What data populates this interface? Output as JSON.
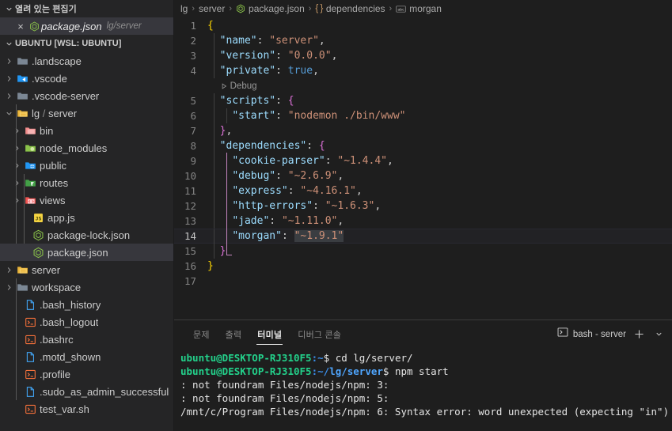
{
  "sidebar": {
    "open_editors": {
      "title": "열려 있는 편집기",
      "items": [
        {
          "name": "package.json",
          "path": "lg/server",
          "icon": "nodejs-json-icon",
          "close": "×"
        }
      ]
    },
    "explorer_root": "UBUNTU [WSL: UBUNTU]",
    "tree": [
      {
        "label": ".landscape",
        "type": "folder",
        "icon": "folder-grey-icon",
        "expanded": false,
        "depth": 1
      },
      {
        "label": ".vscode",
        "type": "folder",
        "icon": "folder-vscode-icon",
        "expanded": false,
        "depth": 1
      },
      {
        "label": ".vscode-server",
        "type": "folder",
        "icon": "folder-grey-icon",
        "expanded": false,
        "depth": 1
      },
      {
        "label": "lg",
        "label_suffix": "server",
        "type": "folder",
        "icon": "folder-open-yellow-icon",
        "expanded": true,
        "depth": 1
      },
      {
        "label": "bin",
        "type": "folder",
        "icon": "folder-pink-icon",
        "expanded": false,
        "depth": 2
      },
      {
        "label": "node_modules",
        "type": "folder",
        "icon": "folder-node-icon",
        "expanded": false,
        "depth": 2
      },
      {
        "label": "public",
        "type": "folder",
        "icon": "folder-public-icon",
        "expanded": false,
        "depth": 2
      },
      {
        "label": "routes",
        "type": "folder",
        "icon": "folder-routes-icon",
        "expanded": false,
        "depth": 2
      },
      {
        "label": "views",
        "type": "folder",
        "icon": "folder-views-icon",
        "expanded": false,
        "depth": 2
      },
      {
        "label": "app.js",
        "type": "file",
        "icon": "javascript-icon",
        "depth": 3
      },
      {
        "label": "package-lock.json",
        "type": "file",
        "icon": "nodejs-json-icon",
        "depth": 3
      },
      {
        "label": "package.json",
        "type": "file",
        "icon": "nodejs-json-icon",
        "depth": 3,
        "selected": true
      },
      {
        "label": "server",
        "type": "folder",
        "icon": "folder-open-yellow-icon",
        "expanded": false,
        "depth": 1
      },
      {
        "label": "workspace",
        "type": "folder",
        "icon": "folder-grey-icon",
        "expanded": false,
        "depth": 1
      },
      {
        "label": ".bash_history",
        "type": "file",
        "icon": "file-blue-icon",
        "depth": 2
      },
      {
        "label": ".bash_logout",
        "type": "file",
        "icon": "console-icon",
        "depth": 2
      },
      {
        "label": ".bashrc",
        "type": "file",
        "icon": "console-icon",
        "depth": 2
      },
      {
        "label": ".motd_shown",
        "type": "file",
        "icon": "file-blue-icon",
        "depth": 2
      },
      {
        "label": ".profile",
        "type": "file",
        "icon": "console-icon",
        "depth": 2
      },
      {
        "label": ".sudo_as_admin_successful",
        "type": "file",
        "icon": "file-blue-icon",
        "depth": 2
      },
      {
        "label": "test_var.sh",
        "type": "file",
        "icon": "console-icon",
        "depth": 2
      }
    ]
  },
  "breadcrumbs": {
    "items": [
      {
        "label": "lg",
        "icon": null
      },
      {
        "label": "server",
        "icon": null
      },
      {
        "label": "package.json",
        "icon": "nodejs-json-icon"
      },
      {
        "label": "dependencies",
        "icon": "braces-icon"
      },
      {
        "label": "morgan",
        "icon": "string-abc-icon"
      }
    ],
    "separator": "›"
  },
  "editor": {
    "active_line": 14,
    "codelens": {
      "line_after": 4,
      "label": "Debug",
      "icon": "run-triangle-icon"
    },
    "lines": [
      {
        "n": 1,
        "indent": 0,
        "tokens": [
          {
            "t": "{",
            "c": "br-y"
          }
        ]
      },
      {
        "n": 2,
        "indent": 1,
        "tokens": [
          {
            "t": "\"name\"",
            "c": "key"
          },
          {
            "t": ": ",
            "c": "punct"
          },
          {
            "t": "\"server\"",
            "c": "str"
          },
          {
            "t": ",",
            "c": "punct"
          }
        ]
      },
      {
        "n": 3,
        "indent": 1,
        "tokens": [
          {
            "t": "\"version\"",
            "c": "key"
          },
          {
            "t": ": ",
            "c": "punct"
          },
          {
            "t": "\"0.0.0\"",
            "c": "str"
          },
          {
            "t": ",",
            "c": "punct"
          }
        ]
      },
      {
        "n": 4,
        "indent": 1,
        "tokens": [
          {
            "t": "\"private\"",
            "c": "key"
          },
          {
            "t": ": ",
            "c": "punct"
          },
          {
            "t": "true",
            "c": "bool"
          },
          {
            "t": ",",
            "c": "punct"
          }
        ]
      },
      {
        "n": 5,
        "indent": 1,
        "tokens": [
          {
            "t": "\"scripts\"",
            "c": "key"
          },
          {
            "t": ": ",
            "c": "punct"
          },
          {
            "t": "{",
            "c": "br-p"
          }
        ]
      },
      {
        "n": 6,
        "indent": 2,
        "tokens": [
          {
            "t": "\"start\"",
            "c": "key"
          },
          {
            "t": ": ",
            "c": "punct"
          },
          {
            "t": "\"nodemon ./bin/www\"",
            "c": "str"
          }
        ]
      },
      {
        "n": 7,
        "indent": 1,
        "tokens": [
          {
            "t": "}",
            "c": "br-p"
          },
          {
            "t": ",",
            "c": "punct"
          }
        ]
      },
      {
        "n": 8,
        "indent": 1,
        "tokens": [
          {
            "t": "\"dependencies\"",
            "c": "key"
          },
          {
            "t": ": ",
            "c": "punct"
          },
          {
            "t": "{",
            "c": "br-p"
          }
        ]
      },
      {
        "n": 9,
        "indent": 2,
        "tokens": [
          {
            "t": "\"cookie-parser\"",
            "c": "key"
          },
          {
            "t": ": ",
            "c": "punct"
          },
          {
            "t": "\"~1.4.4\"",
            "c": "str"
          },
          {
            "t": ",",
            "c": "punct"
          }
        ]
      },
      {
        "n": 10,
        "indent": 2,
        "tokens": [
          {
            "t": "\"debug\"",
            "c": "key"
          },
          {
            "t": ": ",
            "c": "punct"
          },
          {
            "t": "\"~2.6.9\"",
            "c": "str"
          },
          {
            "t": ",",
            "c": "punct"
          }
        ]
      },
      {
        "n": 11,
        "indent": 2,
        "tokens": [
          {
            "t": "\"express\"",
            "c": "key"
          },
          {
            "t": ": ",
            "c": "punct"
          },
          {
            "t": "\"~4.16.1\"",
            "c": "str"
          },
          {
            "t": ",",
            "c": "punct"
          }
        ]
      },
      {
        "n": 12,
        "indent": 2,
        "tokens": [
          {
            "t": "\"http-errors\"",
            "c": "key"
          },
          {
            "t": ": ",
            "c": "punct"
          },
          {
            "t": "\"~1.6.3\"",
            "c": "str"
          },
          {
            "t": ",",
            "c": "punct"
          }
        ]
      },
      {
        "n": 13,
        "indent": 2,
        "tokens": [
          {
            "t": "\"jade\"",
            "c": "key"
          },
          {
            "t": ": ",
            "c": "punct"
          },
          {
            "t": "\"~1.11.0\"",
            "c": "str"
          },
          {
            "t": ",",
            "c": "punct"
          }
        ]
      },
      {
        "n": 14,
        "indent": 2,
        "tokens": [
          {
            "t": "\"morgan\"",
            "c": "key"
          },
          {
            "t": ": ",
            "c": "punct"
          },
          {
            "t": "\"~1.9.1\"",
            "c": "str",
            "sel": true
          }
        ]
      },
      {
        "n": 15,
        "indent": 1,
        "tokens": [
          {
            "t": "}",
            "c": "br-p"
          }
        ]
      },
      {
        "n": 16,
        "indent": 0,
        "tokens": [
          {
            "t": "}",
            "c": "br-y"
          }
        ]
      },
      {
        "n": 17,
        "indent": 0,
        "tokens": []
      }
    ]
  },
  "panel": {
    "tabs": [
      {
        "label": "문제",
        "active": false
      },
      {
        "label": "출력",
        "active": false
      },
      {
        "label": "터미널",
        "active": true
      },
      {
        "label": "디버그 콘솔",
        "active": false
      }
    ],
    "terminal_selector": {
      "label": "bash - server",
      "icon": "terminal-icon"
    },
    "actions": [
      {
        "name": "new-terminal-button",
        "glyph": "+"
      },
      {
        "name": "terminal-dropdown-button",
        "glyph": "⌄"
      }
    ],
    "terminal_lines": [
      {
        "segments": [
          {
            "t": "ubuntu@DESKTOP-RJ310F5",
            "c": "green"
          },
          {
            "t": ":",
            "c": "blue"
          },
          {
            "t": "~",
            "c": "blue"
          },
          {
            "t": "$ cd lg/server/",
            "c": "white"
          }
        ]
      },
      {
        "segments": [
          {
            "t": "ubuntu@DESKTOP-RJ310F5",
            "c": "green"
          },
          {
            "t": ":",
            "c": "blue"
          },
          {
            "t": "~/",
            "c": "blue"
          },
          {
            "t": "lg/server",
            "c": "lblue"
          },
          {
            "t": "$ npm start",
            "c": "white"
          }
        ]
      },
      {
        "segments": [
          {
            "t": ": not foundram Files/nodejs/npm: 3:",
            "c": "white"
          }
        ]
      },
      {
        "segments": [
          {
            "t": ": not foundram Files/nodejs/npm: 5:",
            "c": "white"
          }
        ]
      },
      {
        "segments": [
          {
            "t": "/mnt/c/Program Files/nodejs/npm: 6: Syntax error: word unexpected (expecting \"in\")",
            "c": "white"
          }
        ]
      }
    ]
  },
  "colors": {
    "sidebar_bg": "#252526",
    "editor_bg": "#1e1e1e",
    "selection": "#37373d",
    "accent_string": "#ce9178",
    "accent_key": "#9cdcfe",
    "bracket_pink": "#c586c0",
    "terminal_green": "#23d18b",
    "terminal_blue": "#3b8eea"
  }
}
